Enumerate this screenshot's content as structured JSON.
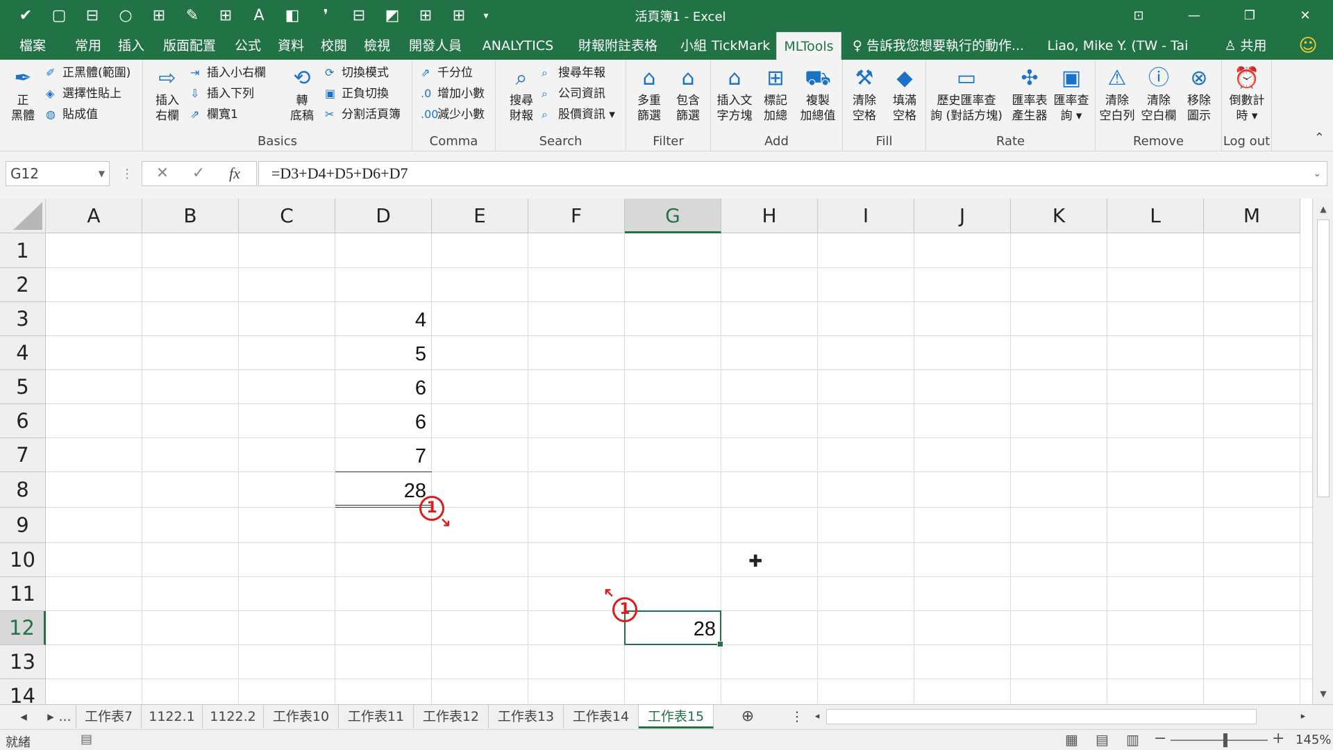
{
  "window": {
    "title": "活頁簿1 - Excel"
  },
  "qat": [
    "✔",
    "▢",
    "⊟",
    "○",
    "⊞",
    "✎",
    "⊞",
    "A",
    "◧",
    "❜",
    "⊟",
    "◩",
    "⊞",
    "⊞",
    "▾"
  ],
  "tabs": [
    "檔案",
    "常用",
    "插入",
    "版面配置",
    "公式",
    "資料",
    "校閱",
    "檢視",
    "開發人員",
    "ANALYTICS",
    "財報附註表格",
    "小組",
    "TickMark",
    "MLTools"
  ],
  "tell_me": "告訴我您想要執行的動作...",
  "user": "Liao, Mike Y. (TW - Tai Chung)",
  "share": "共用",
  "ribbon": {
    "g1": {
      "big": "正\n黑體",
      "items": [
        "正黑體(範圍)",
        "選擇性貼上",
        "貼成值"
      ]
    },
    "g2": {
      "label": "Basics",
      "big": "插入\n右欄",
      "items": [
        "插入小右欄",
        "插入下列",
        "欄寬1"
      ],
      "big2": "轉\n底稿",
      "items2": [
        "切換模式",
        "正負切換",
        "分割活頁簿"
      ]
    },
    "g3": {
      "label": "Comma",
      "items": [
        "千分位",
        "增加小數",
        "減少小數"
      ]
    },
    "g4": {
      "label": "Search",
      "big": "搜尋\n財報",
      "items": [
        "搜尋年報",
        "公司資訊",
        "股價資訊 ▾"
      ]
    },
    "g5": {
      "label": "Filter",
      "b1": "多重\n篩選",
      "b2": "包含\n篩選"
    },
    "g6": {
      "label": "Add",
      "b1": "插入文\n字方塊",
      "b2": "標記\n加總",
      "b3": "複製\n加總值"
    },
    "g7": {
      "label": "Fill",
      "b1": "清除\n空格",
      "b2": "填滿\n空格"
    },
    "g8": {
      "label": "Rate",
      "b1": "歷史匯率查\n詢 (對話方塊)",
      "b2": "匯率表\n產生器",
      "b3": "匯率查\n詢 ▾"
    },
    "g9": {
      "label": "Remove",
      "b1": "清除\n空白列",
      "b2": "清除\n空白欄",
      "b3": "移除\n圖示"
    },
    "g10": {
      "label": "Log out",
      "b1": "倒數計\n時 ▾"
    }
  },
  "formula": {
    "namebox": "G12",
    "cancel": "✕",
    "enter": "✓",
    "fx": "fx",
    "value": "=D3+D4+D5+D6+D7"
  },
  "columns": [
    "A",
    "B",
    "C",
    "D",
    "E",
    "F",
    "G",
    "H",
    "I",
    "J",
    "K",
    "L",
    "M"
  ],
  "rows": [
    "1",
    "2",
    "3",
    "4",
    "5",
    "6",
    "7",
    "8",
    "9",
    "10",
    "11",
    "12",
    "13",
    "14"
  ],
  "cells": {
    "D3": "4",
    "D4": "5",
    "D5": "6",
    "D6": "6",
    "D7": "7",
    "D8": "28",
    "G12": "28"
  },
  "annotations": [
    "1",
    "1"
  ],
  "sheets": [
    "...",
    "工作表7",
    "1122.1",
    "1122.2",
    "工作表10",
    "工作表11",
    "工作表12",
    "工作表13",
    "工作表14",
    "工作表15"
  ],
  "status": {
    "ready": "就緒",
    "zoom": "145%"
  },
  "colors": {
    "accent": "#217346",
    "annotation": "#e0191b"
  }
}
